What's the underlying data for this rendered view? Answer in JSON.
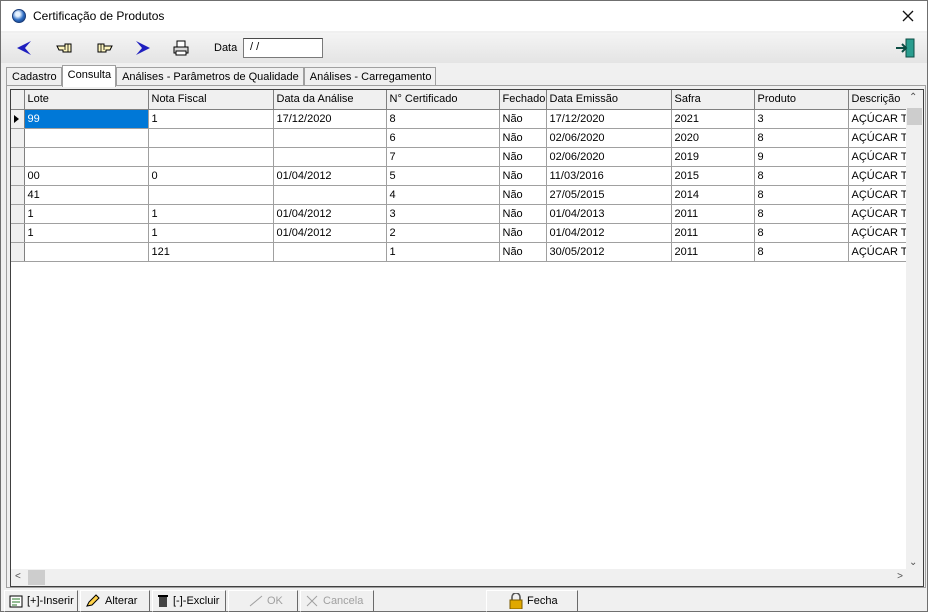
{
  "window": {
    "title": "Certificação de Produtos"
  },
  "toolbar": {
    "date_label": "Data",
    "date_value": " / /",
    "buttons": [
      "prev-icon",
      "hand-left-icon",
      "hand-right-icon",
      "next-icon",
      "printer-icon",
      "exit-door-icon"
    ]
  },
  "tabs": [
    {
      "label": "Cadastro",
      "active": false
    },
    {
      "label": "Consulta",
      "active": true
    },
    {
      "label": "Análises - Parâmetros de Qualidade",
      "active": false
    },
    {
      "label": "Análises - Carregamento",
      "active": false
    }
  ],
  "grid": {
    "columns": [
      "Lote",
      "Nota Fiscal",
      "Data da Análise",
      "N° Certificado",
      "Fechado",
      "Data Emissão",
      "Safra",
      "Produto",
      "Descrição"
    ],
    "rows": [
      [
        "99",
        "1",
        "17/12/2020",
        "8",
        "Não",
        "17/12/2020",
        "2021",
        "3",
        "AÇÚCAR T"
      ],
      [
        "",
        "",
        "",
        "6",
        "Não",
        "02/06/2020",
        "2020",
        "8",
        "AÇÚCAR T"
      ],
      [
        "",
        "",
        "",
        "7",
        "Não",
        "02/06/2020",
        "2019",
        "9",
        "AÇÚCAR T"
      ],
      [
        "00",
        "0",
        "01/04/2012",
        "5",
        "Não",
        "11/03/2016",
        "2015",
        "8",
        "AÇÚCAR T"
      ],
      [
        "41",
        "",
        "",
        "4",
        "Não",
        "27/05/2015",
        "2014",
        "8",
        "AÇÚCAR T"
      ],
      [
        "1",
        "1",
        "01/04/2012",
        "3",
        "Não",
        "01/04/2013",
        "2011",
        "8",
        "AÇÚCAR T"
      ],
      [
        "1",
        "1",
        "01/04/2012",
        "2",
        "Não",
        "01/04/2012",
        "2011",
        "8",
        "AÇÚCAR T"
      ],
      [
        "",
        "121",
        "",
        "1",
        "Não",
        "30/05/2012",
        "2011",
        "8",
        "AÇÚCAR T"
      ]
    ],
    "selected_row": 0
  },
  "actions": {
    "insert": "[+]-Inserir",
    "alter": "Alterar",
    "delete": "[-]-Excluir",
    "ok": "OK",
    "cancel": "Cancela",
    "close": "Fecha"
  },
  "colors": {
    "selection": "#0078d7",
    "prev_next_arrow": "#1f1fbf"
  }
}
